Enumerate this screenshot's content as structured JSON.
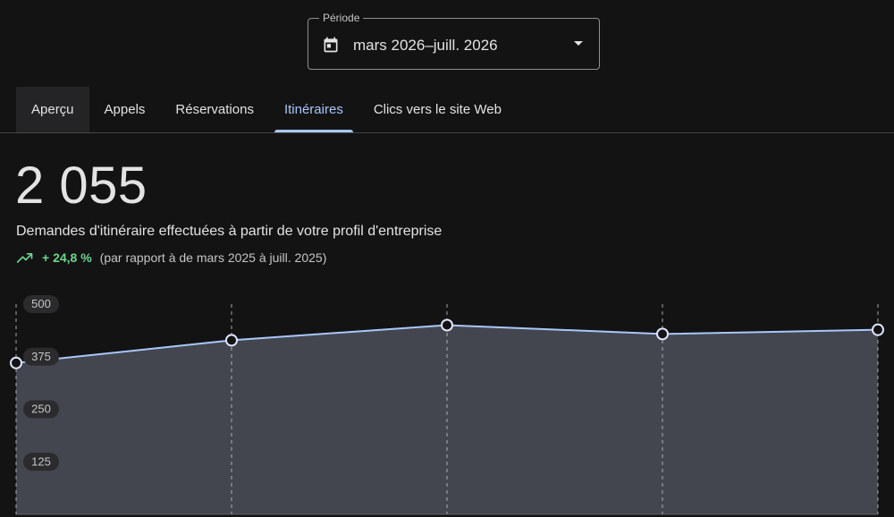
{
  "period": {
    "label": "Période",
    "value": "mars 2026–juill. 2026"
  },
  "tabs": [
    {
      "label": "Aperçu",
      "selected": true
    },
    {
      "label": "Appels"
    },
    {
      "label": "Réservations"
    },
    {
      "label": "Itinéraires",
      "active": true
    },
    {
      "label": "Clics vers le site Web"
    }
  ],
  "metric": {
    "value": "2 055",
    "description": "Demandes d'itinéraire effectuées à partir de votre profil d'entreprise",
    "change": "+ 24,8 %",
    "comparison": "(par rapport à de mars 2025 à juill. 2025)"
  },
  "colors": {
    "background": "#131314",
    "accent": "#a8c7fa",
    "positive": "#6dd58c",
    "area_fill": "#44464f"
  },
  "chart_data": {
    "type": "area",
    "y_ticks": [
      125,
      250,
      375,
      500
    ],
    "ylim": [
      0,
      500
    ],
    "grid": "vertical dashed lines at data points",
    "series": [
      {
        "values": [
          360,
          414,
          450,
          429,
          439
        ]
      }
    ]
  }
}
